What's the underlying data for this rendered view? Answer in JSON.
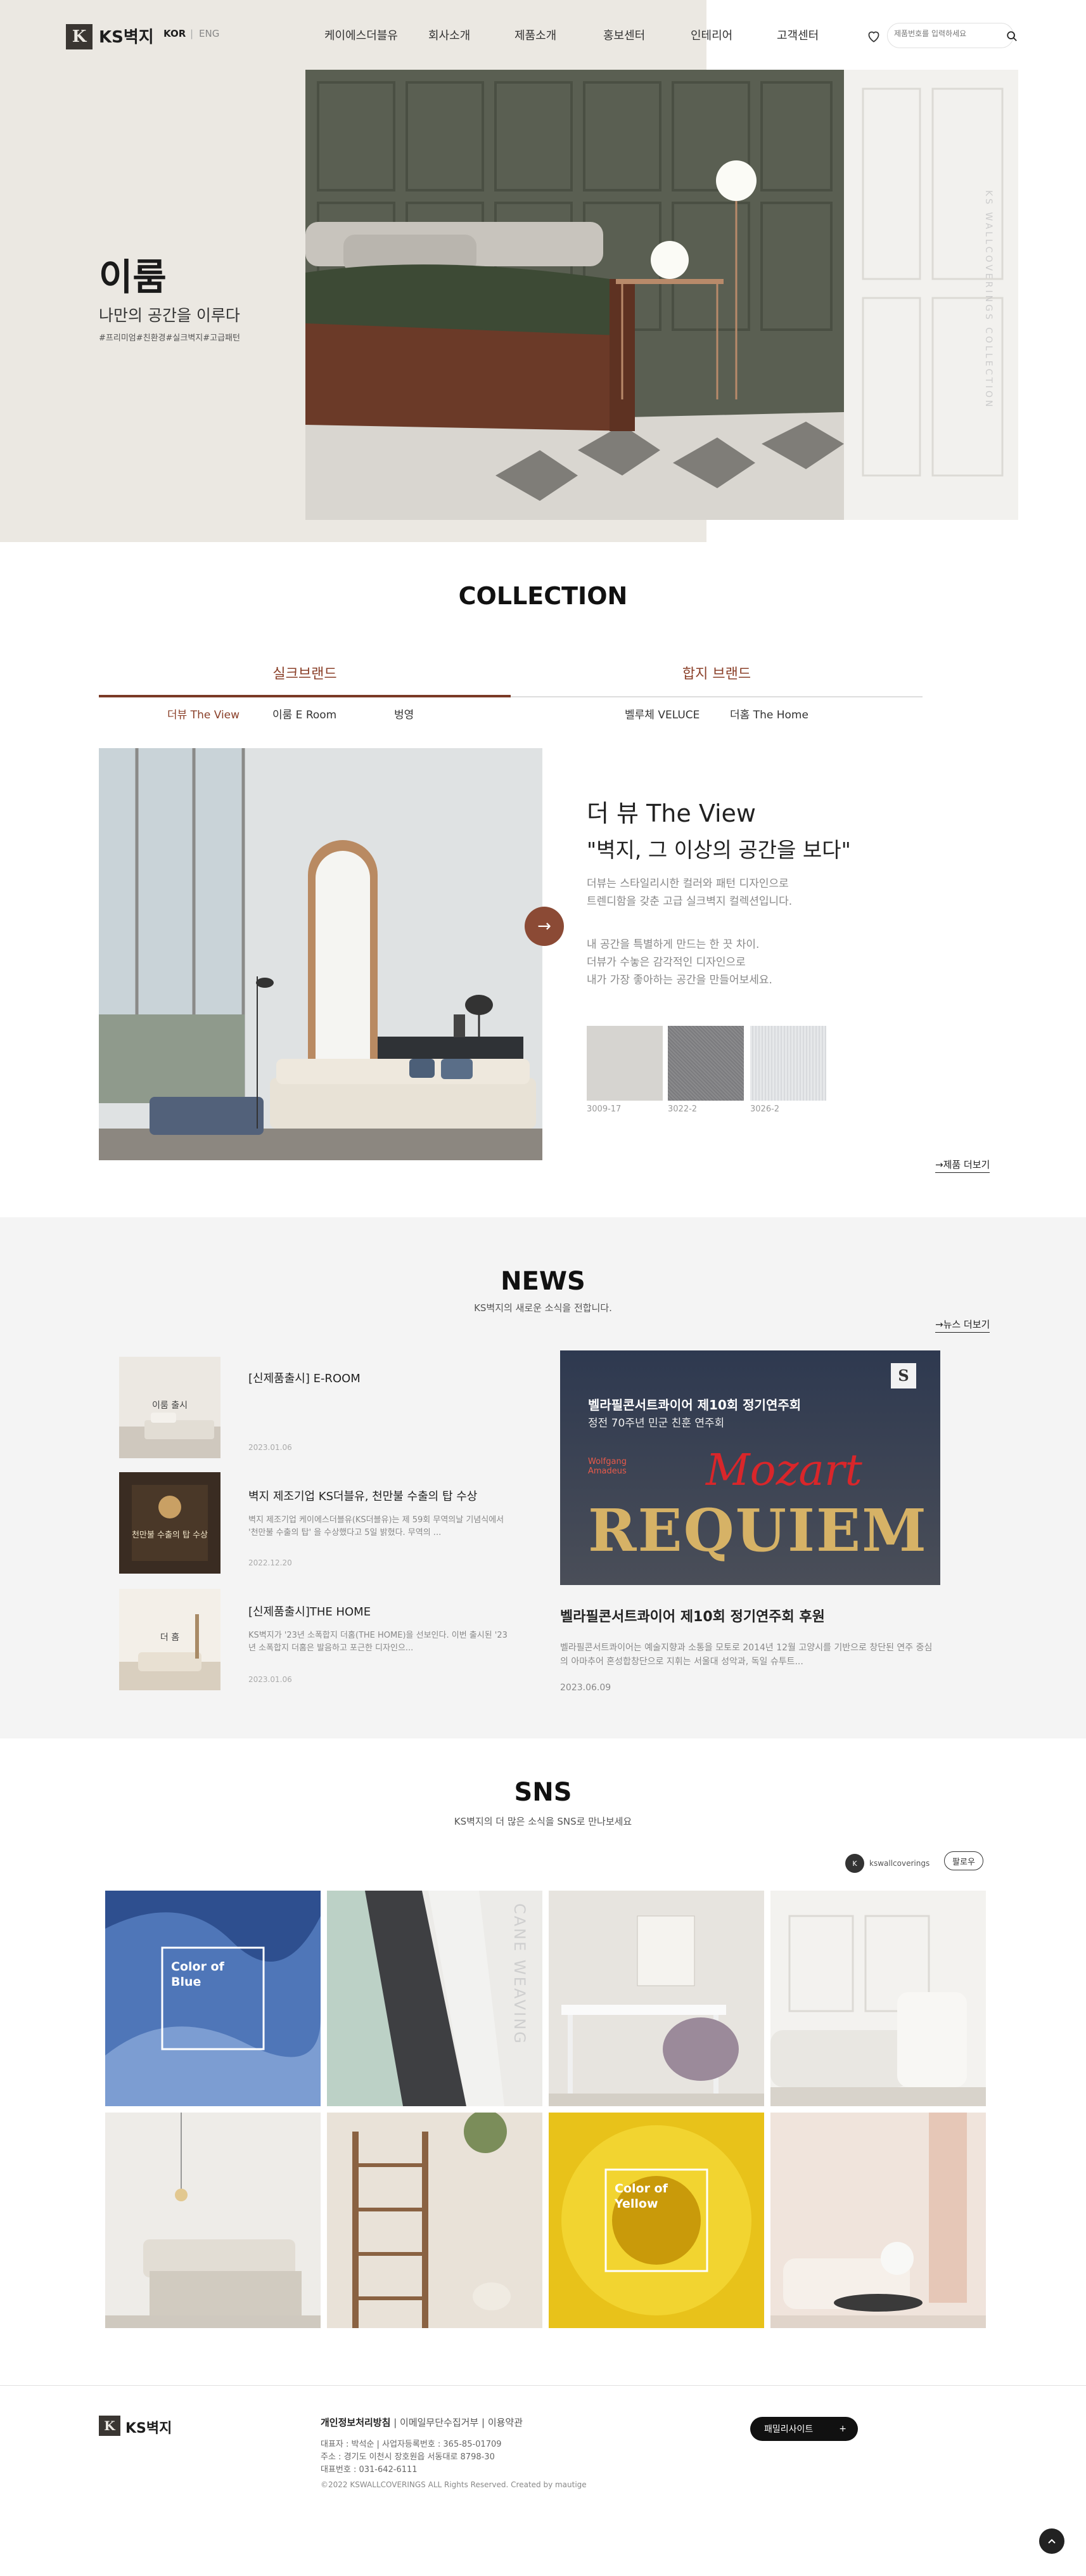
{
  "header": {
    "logo_mark": "K",
    "logo_text": "KS벽지",
    "lang_active": "KOR",
    "lang_sep": "|",
    "lang_other": "ENG",
    "nav": [
      "케이에스더블유",
      "회사소개",
      "제품소개",
      "홍보센터",
      "인테리어",
      "고객센터"
    ],
    "search_placeholder": "제품번호를 입력하세요"
  },
  "hero": {
    "title": "이룸",
    "subtitle": "나만의 공간을 이루다",
    "tags": "#프리미엄#친환경#실크벽지#고급패턴",
    "side_text": "KS WALLCOVERINGS COLLECTION"
  },
  "collection": {
    "title": "COLLECTION",
    "brand_tabs": [
      "실크브랜드",
      "합지 브랜드"
    ],
    "sub_tabs_left": [
      "더뷰 The View",
      "이룸 E Room",
      "벙영"
    ],
    "sub_tabs_right": [
      "벨루체 VELUCE",
      "더홈 The Home"
    ],
    "arrow": "→",
    "product_title": "더 뷰 The View",
    "product_slogan": "\"벽지, 그 이상의 공간을 보다\"",
    "desc1_lines": [
      "더뷰는 스타일리시한 컬러와 패턴 디자인으로",
      "트렌디함을 갖춘 고급 실크벽지 컬렉션입니다."
    ],
    "desc2_lines": [
      "내 공간을 특별하게 만드는 한 끗 차이.",
      "더뷰가 수놓은 감각적인 디자인으로",
      "내가 가장 좋아하는 공간을 만들어보세요."
    ],
    "swatches": [
      {
        "code": "3009-17",
        "color": "#d6d4d0"
      },
      {
        "code": "3022-2",
        "color": "#8a8a8c"
      },
      {
        "code": "3026-2",
        "color": "#e4e6e8"
      }
    ],
    "more_link": "→제품 더보기"
  },
  "news": {
    "title": "NEWS",
    "subtitle": "KS벽지의 새로운 소식을 전합니다.",
    "more_link": "→뉴스 더보기",
    "items": [
      {
        "title": "[신제품출시] E-ROOM",
        "desc": "",
        "date": "2023.01.06",
        "thumb_label": "이룸 출시"
      },
      {
        "title": "벽지 제조기업 KS더블유, 천만불 수출의 탑 수상",
        "desc": "벽지 제조기업 케이에스더블유(KS더블유)는 제 59회 무역의날 기념식에서 '천만불 수출의 탑' 을 수상했다고 5일 밝혔다. 무역의 ...",
        "date": "2022.12.20",
        "thumb_label": "천만불 수출의 탑 수상"
      },
      {
        "title": "[신제품출시]THE HOME",
        "desc": "KS벽지가 '23년 소폭합지 더홈(THE HOME)을 선보인다. 이번 출시된 '23년 소폭합지 더홈은 발음하고 포근한 디자인으...",
        "date": "2023.01.06",
        "thumb_label": "더 홈"
      }
    ],
    "feature": {
      "poster_line1": "벨라필콘서트콰이어 제10회 정기연주회",
      "poster_line2": "정전 70주년 민군 친훈 연주회",
      "poster_script": "Mozart",
      "poster_small": "Wolfgang Amadeus",
      "poster_big": "REQUIEM",
      "title": "벨라필콘서트콰이어 제10회 정기연주회 후원",
      "desc": "벨라필콘서트콰이어는 예술지향과 소통을 모토로 2014년 12월 고양시를 기반으로 창단된 연주 중심의 아마추어 혼성합창단으로 지휘는 서울대 성악과, 독일 슈투트...",
      "date": "2023.06.09"
    }
  },
  "sns": {
    "title": "SNS",
    "subtitle": "KS벽지의 더 많은 소식을 SNS로 만나보세요",
    "handle": "kswallcoverings",
    "follow": "팔로우",
    "tile_text": [
      "Color of Blue",
      "CANE WEAVING",
      "Color of Yellow"
    ]
  },
  "footer": {
    "logo_text": "KS벽지",
    "link_privacy": "개인정보처리방침",
    "link_email": "이메일무단수집거부",
    "link_terms": "이용약관",
    "info_ceo": "대표자 : 박석순 | 사업자등록번호 : 365-85-01709",
    "info_address": "주소 : 경기도 이천시 장호원읍 서동대로 8798-30",
    "info_phone": "대표번호 : 031-642-6111",
    "copyright": "©2022 KSWALLCOVERINGS ALL Rights Reserved. Created by mautige",
    "family_site": "패밀리사이트",
    "family_plus": "+"
  },
  "colors": {
    "accent": "#8a3f28",
    "hero_bg": "#ebe8e2",
    "news_bg": "#f4f4f4"
  }
}
